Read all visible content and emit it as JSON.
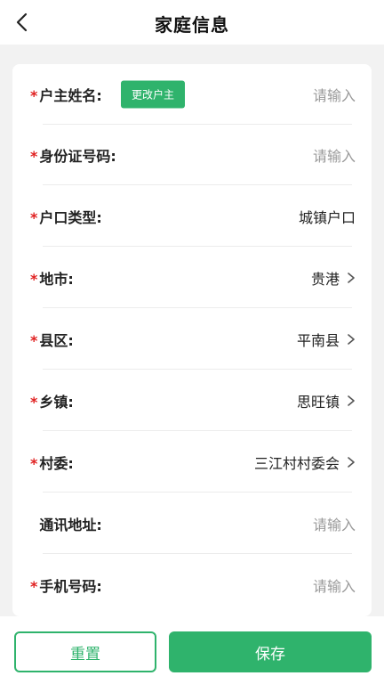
{
  "header": {
    "title": "家庭信息"
  },
  "form": {
    "required_mark": "*",
    "change_owner_button": "更改户主",
    "rows": [
      {
        "label": "户主姓名:",
        "required": true,
        "value": "请输入",
        "is_placeholder": true,
        "chevron": false
      },
      {
        "label": "身份证号码:",
        "required": true,
        "value": "请输入",
        "is_placeholder": true,
        "chevron": false
      },
      {
        "label": "户口类型:",
        "required": true,
        "value": "城镇户口",
        "is_placeholder": false,
        "chevron": false
      },
      {
        "label": "地市:",
        "required": true,
        "value": "贵港",
        "is_placeholder": false,
        "chevron": true
      },
      {
        "label": "县区:",
        "required": true,
        "value": "平南县",
        "is_placeholder": false,
        "chevron": true
      },
      {
        "label": "乡镇:",
        "required": true,
        "value": "思旺镇",
        "is_placeholder": false,
        "chevron": true
      },
      {
        "label": "村委:",
        "required": true,
        "value": "三江村村委会",
        "is_placeholder": false,
        "chevron": true
      },
      {
        "label": "通讯地址:",
        "required": false,
        "value": "请输入",
        "is_placeholder": true,
        "chevron": false
      },
      {
        "label": "手机号码:",
        "required": true,
        "value": "请输入",
        "is_placeholder": true,
        "chevron": false
      }
    ]
  },
  "footer": {
    "reset_label": "重置",
    "save_label": "保存"
  },
  "colors": {
    "accent": "#2fb36c",
    "required": "#e02020",
    "placeholder": "#9a9a9a"
  }
}
